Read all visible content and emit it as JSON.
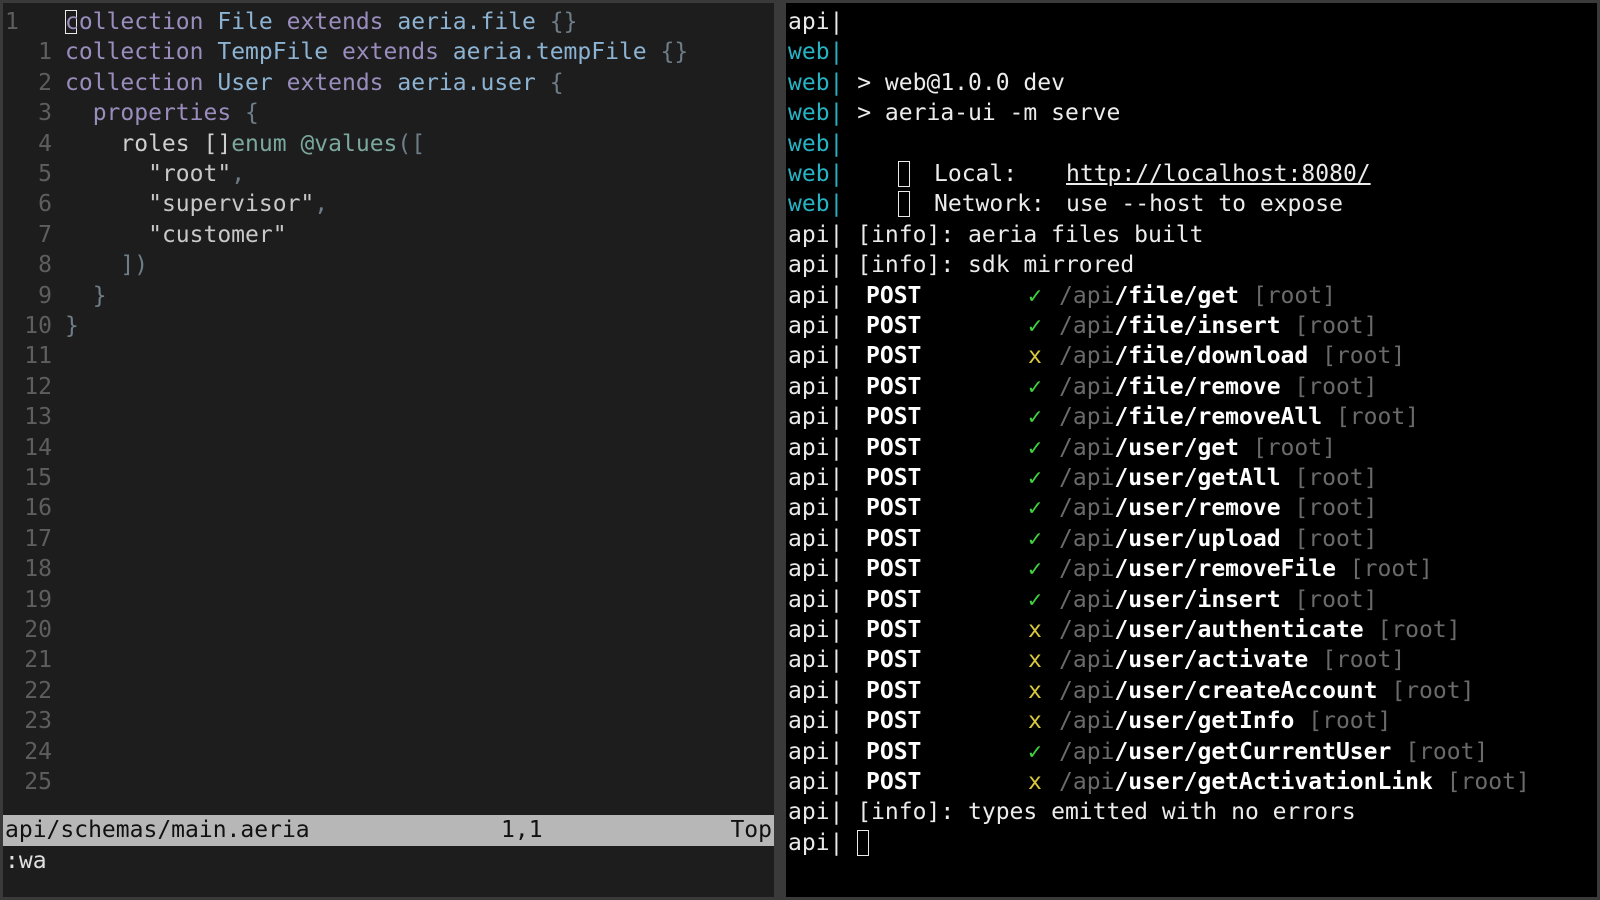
{
  "editor": {
    "cursor_line_number": "1",
    "lines": [
      {
        "n": "1",
        "abs": true,
        "tokens": [
          [
            "kw",
            "collection"
          ],
          [
            "sp",
            " "
          ],
          [
            "ty",
            "File"
          ],
          [
            "sp",
            " "
          ],
          [
            "kw",
            "extends"
          ],
          [
            "sp",
            " "
          ],
          [
            "ty",
            "aeria.file"
          ],
          [
            "sp",
            " "
          ],
          [
            "pn",
            "{}"
          ]
        ]
      },
      {
        "n": "1",
        "tokens": [
          [
            "kw",
            "collection"
          ],
          [
            "sp",
            " "
          ],
          [
            "ty",
            "TempFile"
          ],
          [
            "sp",
            " "
          ],
          [
            "kw",
            "extends"
          ],
          [
            "sp",
            " "
          ],
          [
            "ty",
            "aeria.tempFile"
          ],
          [
            "sp",
            " "
          ],
          [
            "pn",
            "{}"
          ]
        ]
      },
      {
        "n": "2",
        "tokens": [
          [
            "kw",
            "collection"
          ],
          [
            "sp",
            " "
          ],
          [
            "ty",
            "User"
          ],
          [
            "sp",
            " "
          ],
          [
            "kw",
            "extends"
          ],
          [
            "sp",
            " "
          ],
          [
            "ty",
            "aeria.user"
          ],
          [
            "sp",
            " "
          ],
          [
            "pn",
            "{"
          ]
        ]
      },
      {
        "n": "3",
        "tokens": [
          [
            "sp",
            "  "
          ],
          [
            "kw",
            "properties"
          ],
          [
            "sp",
            " "
          ],
          [
            "pn",
            "{"
          ]
        ]
      },
      {
        "n": "4",
        "tokens": [
          [
            "sp",
            "    "
          ],
          [
            "id",
            "roles"
          ],
          [
            "sp",
            " "
          ],
          [
            "id",
            "[]"
          ],
          [
            "fn",
            "enum"
          ],
          [
            "sp",
            " "
          ],
          [
            "fn",
            "@values"
          ],
          [
            "pn",
            "(["
          ]
        ]
      },
      {
        "n": "5",
        "tokens": [
          [
            "sp",
            "      "
          ],
          [
            "str",
            "\"root\""
          ],
          [
            "pn",
            ","
          ]
        ]
      },
      {
        "n": "6",
        "tokens": [
          [
            "sp",
            "      "
          ],
          [
            "str",
            "\"supervisor\""
          ],
          [
            "pn",
            ","
          ]
        ]
      },
      {
        "n": "7",
        "tokens": [
          [
            "sp",
            "      "
          ],
          [
            "str",
            "\"customer\""
          ]
        ]
      },
      {
        "n": "8",
        "tokens": [
          [
            "sp",
            "    "
          ],
          [
            "pn",
            "])"
          ]
        ]
      },
      {
        "n": "9",
        "tokens": [
          [
            "sp",
            "  "
          ],
          [
            "pn",
            "}"
          ]
        ]
      },
      {
        "n": "10",
        "tokens": [
          [
            "pn",
            "}"
          ]
        ]
      },
      {
        "n": "11",
        "tokens": []
      },
      {
        "n": "12",
        "tokens": []
      },
      {
        "n": "13",
        "tokens": []
      },
      {
        "n": "14",
        "tokens": []
      },
      {
        "n": "15",
        "tokens": []
      },
      {
        "n": "16",
        "tokens": []
      },
      {
        "n": "17",
        "tokens": []
      },
      {
        "n": "18",
        "tokens": []
      },
      {
        "n": "19",
        "tokens": []
      },
      {
        "n": "20",
        "tokens": []
      },
      {
        "n": "21",
        "tokens": []
      },
      {
        "n": "22",
        "tokens": []
      },
      {
        "n": "23",
        "tokens": []
      },
      {
        "n": "24",
        "tokens": []
      },
      {
        "n": "25",
        "tokens": []
      }
    ],
    "status": {
      "filename": "api/schemas/main.aeria",
      "position": "1,1",
      "scroll": "Top"
    },
    "command": ":wa"
  },
  "terminal": {
    "lines": [
      {
        "kind": "plain",
        "prefix": "api|",
        "source": "api",
        "text": ""
      },
      {
        "kind": "plain",
        "prefix": "web|",
        "source": "web",
        "text": ""
      },
      {
        "kind": "plain",
        "prefix": "web|",
        "source": "web",
        "text": " > web@1.0.0 dev"
      },
      {
        "kind": "plain",
        "prefix": "web|",
        "source": "web",
        "text": " > aeria-ui -m serve"
      },
      {
        "kind": "plain",
        "prefix": "web|",
        "source": "web",
        "text": ""
      },
      {
        "kind": "local",
        "prefix": "web|",
        "source": "web",
        "label": "Local:",
        "url": "http://localhost:8080/"
      },
      {
        "kind": "network",
        "prefix": "web|",
        "source": "web",
        "label": "Network:",
        "text": "use --host to expose"
      },
      {
        "kind": "plain",
        "prefix": "api|",
        "source": "api",
        "text": " [info]: aeria files built"
      },
      {
        "kind": "plain",
        "prefix": "api|",
        "source": "api",
        "text": " [info]: sdk mirrored"
      },
      {
        "kind": "route",
        "prefix": "api|",
        "method": "POST",
        "ok": true,
        "mark": "✓",
        "api": "/api",
        "path": "/file/get",
        "role": "[root]"
      },
      {
        "kind": "route",
        "prefix": "api|",
        "method": "POST",
        "ok": true,
        "mark": "✓",
        "api": "/api",
        "path": "/file/insert",
        "role": "[root]"
      },
      {
        "kind": "route",
        "prefix": "api|",
        "method": "POST",
        "ok": false,
        "mark": "x",
        "api": "/api",
        "path": "/file/download",
        "role": "[root]"
      },
      {
        "kind": "route",
        "prefix": "api|",
        "method": "POST",
        "ok": true,
        "mark": "✓",
        "api": "/api",
        "path": "/file/remove",
        "role": "[root]"
      },
      {
        "kind": "route",
        "prefix": "api|",
        "method": "POST",
        "ok": true,
        "mark": "✓",
        "api": "/api",
        "path": "/file/removeAll",
        "role": "[root]"
      },
      {
        "kind": "route",
        "prefix": "api|",
        "method": "POST",
        "ok": true,
        "mark": "✓",
        "api": "/api",
        "path": "/user/get",
        "role": "[root]"
      },
      {
        "kind": "route",
        "prefix": "api|",
        "method": "POST",
        "ok": true,
        "mark": "✓",
        "api": "/api",
        "path": "/user/getAll",
        "role": "[root]"
      },
      {
        "kind": "route",
        "prefix": "api|",
        "method": "POST",
        "ok": true,
        "mark": "✓",
        "api": "/api",
        "path": "/user/remove",
        "role": "[root]"
      },
      {
        "kind": "route",
        "prefix": "api|",
        "method": "POST",
        "ok": true,
        "mark": "✓",
        "api": "/api",
        "path": "/user/upload",
        "role": "[root]"
      },
      {
        "kind": "route",
        "prefix": "api|",
        "method": "POST",
        "ok": true,
        "mark": "✓",
        "api": "/api",
        "path": "/user/removeFile",
        "role": "[root]"
      },
      {
        "kind": "route",
        "prefix": "api|",
        "method": "POST",
        "ok": true,
        "mark": "✓",
        "api": "/api",
        "path": "/user/insert",
        "role": "[root]"
      },
      {
        "kind": "route",
        "prefix": "api|",
        "method": "POST",
        "ok": false,
        "mark": "x",
        "api": "/api",
        "path": "/user/authenticate",
        "role": "[root]"
      },
      {
        "kind": "route",
        "prefix": "api|",
        "method": "POST",
        "ok": false,
        "mark": "x",
        "api": "/api",
        "path": "/user/activate",
        "role": "[root]"
      },
      {
        "kind": "route",
        "prefix": "api|",
        "method": "POST",
        "ok": false,
        "mark": "x",
        "api": "/api",
        "path": "/user/createAccount",
        "role": "[root]"
      },
      {
        "kind": "route",
        "prefix": "api|",
        "method": "POST",
        "ok": false,
        "mark": "x",
        "api": "/api",
        "path": "/user/getInfo",
        "role": "[root]"
      },
      {
        "kind": "route",
        "prefix": "api|",
        "method": "POST",
        "ok": true,
        "mark": "✓",
        "api": "/api",
        "path": "/user/getCurrentUser",
        "role": "[root]"
      },
      {
        "kind": "route",
        "prefix": "api|",
        "method": "POST",
        "ok": false,
        "mark": "x",
        "api": "/api",
        "path": "/user/getActivationLink",
        "role": "[root]"
      },
      {
        "kind": "plain",
        "prefix": "api|",
        "source": "api",
        "text": " [info]: types emitted with no errors"
      },
      {
        "kind": "prompt",
        "prefix": "api|",
        "source": "api",
        "text": " "
      }
    ]
  },
  "colors": {
    "web_prefix": "#27b3c4",
    "ok": "#3fd33f",
    "fail": "#d8c83c",
    "statusline_bg": "#b7b7b7"
  }
}
